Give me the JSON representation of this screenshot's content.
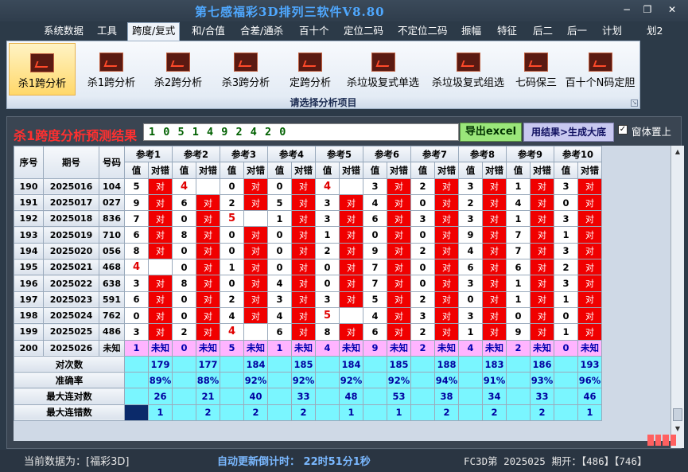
{
  "window": {
    "title": "第七感福彩3D排列三软件V8.80",
    "minimize_glyph": "−",
    "restore_glyph": "❐",
    "close_glyph": "✕"
  },
  "menu": [
    "系统数据",
    "工具",
    "跨度/复式",
    "和/合值",
    "合差/通杀",
    "百十个",
    "定位二码",
    "不定位二码",
    "振幅",
    "特征",
    "后二",
    "后一",
    "计划",
    "划2"
  ],
  "menu_active": "跨度/复式",
  "ribbon": {
    "buttons": [
      "杀1跨分析",
      "杀1跨分析",
      "杀2跨分析",
      "杀3跨分析",
      "定跨分析",
      "杀垃圾复式单选",
      "杀垃圾复式组选",
      "七码保三",
      "百十个N码定胆"
    ],
    "caption": "请选择分析项目"
  },
  "result": {
    "title": "杀1跨度分析预测结果",
    "numbers": "1 0 5 1 4 9 2 4 2 0",
    "excel_button": "导出excel",
    "generate_button": "用结果>生成大底",
    "checkbox_checked": true,
    "checkbox_label": "窗体置上"
  },
  "table": {
    "headers": {
      "seq": "序号",
      "period": "期号",
      "code": "号码",
      "ref_prefix": "参考",
      "value": "值",
      "correct": "对错"
    },
    "refs": [
      "参考1",
      "参考2",
      "参考3",
      "参考4",
      "参考5",
      "参考6",
      "参考7",
      "参考8",
      "参考9",
      "参考10"
    ],
    "correct_text": "对",
    "unknown_text": "未知",
    "rows": [
      {
        "seq": "190",
        "period": "2025016",
        "code": "104",
        "refs": [
          [
            "5",
            1
          ],
          [
            "4",
            0
          ],
          [
            "0",
            1
          ],
          [
            "0",
            1
          ],
          [
            "4",
            0
          ],
          [
            "3",
            1
          ],
          [
            "2",
            1
          ],
          [
            "3",
            1
          ],
          [
            "1",
            1
          ],
          [
            "3",
            1
          ]
        ]
      },
      {
        "seq": "191",
        "period": "2025017",
        "code": "027",
        "refs": [
          [
            "9",
            1
          ],
          [
            "6",
            1
          ],
          [
            "2",
            1
          ],
          [
            "5",
            1
          ],
          [
            "3",
            1
          ],
          [
            "4",
            1
          ],
          [
            "0",
            1
          ],
          [
            "2",
            1
          ],
          [
            "4",
            1
          ],
          [
            "0",
            1
          ]
        ]
      },
      {
        "seq": "192",
        "period": "2025018",
        "code": "836",
        "refs": [
          [
            "7",
            1
          ],
          [
            "0",
            1
          ],
          [
            "5",
            0
          ],
          [
            "1",
            1
          ],
          [
            "3",
            1
          ],
          [
            "6",
            1
          ],
          [
            "3",
            1
          ],
          [
            "3",
            1
          ],
          [
            "1",
            1
          ],
          [
            "3",
            1
          ]
        ]
      },
      {
        "seq": "193",
        "period": "2025019",
        "code": "710",
        "refs": [
          [
            "6",
            1
          ],
          [
            "8",
            1
          ],
          [
            "0",
            1
          ],
          [
            "0",
            1
          ],
          [
            "1",
            1
          ],
          [
            "0",
            1
          ],
          [
            "0",
            1
          ],
          [
            "9",
            1
          ],
          [
            "7",
            1
          ],
          [
            "1",
            1
          ]
        ]
      },
      {
        "seq": "194",
        "period": "2025020",
        "code": "056",
        "refs": [
          [
            "8",
            1
          ],
          [
            "0",
            1
          ],
          [
            "0",
            1
          ],
          [
            "0",
            1
          ],
          [
            "2",
            1
          ],
          [
            "9",
            1
          ],
          [
            "2",
            1
          ],
          [
            "4",
            1
          ],
          [
            "7",
            1
          ],
          [
            "3",
            1
          ]
        ]
      },
      {
        "seq": "195",
        "period": "2025021",
        "code": "468",
        "refs": [
          [
            "4",
            0
          ],
          [
            "0",
            1
          ],
          [
            "1",
            1
          ],
          [
            "0",
            1
          ],
          [
            "0",
            1
          ],
          [
            "7",
            1
          ],
          [
            "0",
            1
          ],
          [
            "6",
            1
          ],
          [
            "6",
            1
          ],
          [
            "2",
            1
          ]
        ]
      },
      {
        "seq": "196",
        "period": "2025022",
        "code": "638",
        "refs": [
          [
            "3",
            1
          ],
          [
            "8",
            1
          ],
          [
            "0",
            1
          ],
          [
            "4",
            1
          ],
          [
            "0",
            1
          ],
          [
            "7",
            1
          ],
          [
            "0",
            1
          ],
          [
            "3",
            1
          ],
          [
            "1",
            1
          ],
          [
            "3",
            1
          ]
        ]
      },
      {
        "seq": "197",
        "period": "2025023",
        "code": "591",
        "refs": [
          [
            "6",
            1
          ],
          [
            "0",
            1
          ],
          [
            "2",
            1
          ],
          [
            "3",
            1
          ],
          [
            "3",
            1
          ],
          [
            "5",
            1
          ],
          [
            "2",
            1
          ],
          [
            "0",
            1
          ],
          [
            "1",
            1
          ],
          [
            "1",
            1
          ]
        ]
      },
      {
        "seq": "198",
        "period": "2025024",
        "code": "762",
        "refs": [
          [
            "0",
            1
          ],
          [
            "0",
            1
          ],
          [
            "4",
            1
          ],
          [
            "4",
            1
          ],
          [
            "5",
            0
          ],
          [
            "4",
            1
          ],
          [
            "3",
            1
          ],
          [
            "3",
            1
          ],
          [
            "0",
            1
          ],
          [
            "0",
            1
          ]
        ]
      },
      {
        "seq": "199",
        "period": "2025025",
        "code": "486",
        "refs": [
          [
            "3",
            1
          ],
          [
            "2",
            1
          ],
          [
            "4",
            0
          ],
          [
            "6",
            1
          ],
          [
            "8",
            1
          ],
          [
            "6",
            1
          ],
          [
            "2",
            1
          ],
          [
            "1",
            1
          ],
          [
            "9",
            1
          ],
          [
            "1",
            1
          ]
        ]
      }
    ],
    "pending": {
      "seq": "200",
      "period": "2025026",
      "code": "未知",
      "values": [
        "1",
        "0",
        "5",
        "1",
        "4",
        "9",
        "2",
        "4",
        "2",
        "0"
      ]
    },
    "stats": [
      {
        "label": "对次数",
        "values": [
          "179",
          "177",
          "184",
          "185",
          "184",
          "185",
          "188",
          "183",
          "186",
          "193"
        ]
      },
      {
        "label": "准确率",
        "values": [
          "89%",
          "88%",
          "92%",
          "92%",
          "92%",
          "92%",
          "94%",
          "91%",
          "93%",
          "96%"
        ]
      },
      {
        "label": "最大连对数",
        "values": [
          "26",
          "21",
          "40",
          "33",
          "48",
          "53",
          "38",
          "34",
          "33",
          "46"
        ]
      },
      {
        "label": "最大连错数",
        "values": [
          "1",
          "2",
          "2",
          "2",
          "1",
          "1",
          "2",
          "2",
          "2",
          "1"
        ]
      }
    ]
  },
  "status": {
    "current": "当前数据为：[福彩3D]",
    "countdown": "自动更新倒计时： 22时51分1秒",
    "draw": "FC3D第 2025025 期开：【486】【746】"
  },
  "colors": {
    "hit": "#f00000",
    "miss": "#ffffff",
    "pending": "#ffb4ff",
    "stats": "#7af6ff",
    "title": "#4fa8ff"
  },
  "icons": [
    "chart-icon"
  ]
}
